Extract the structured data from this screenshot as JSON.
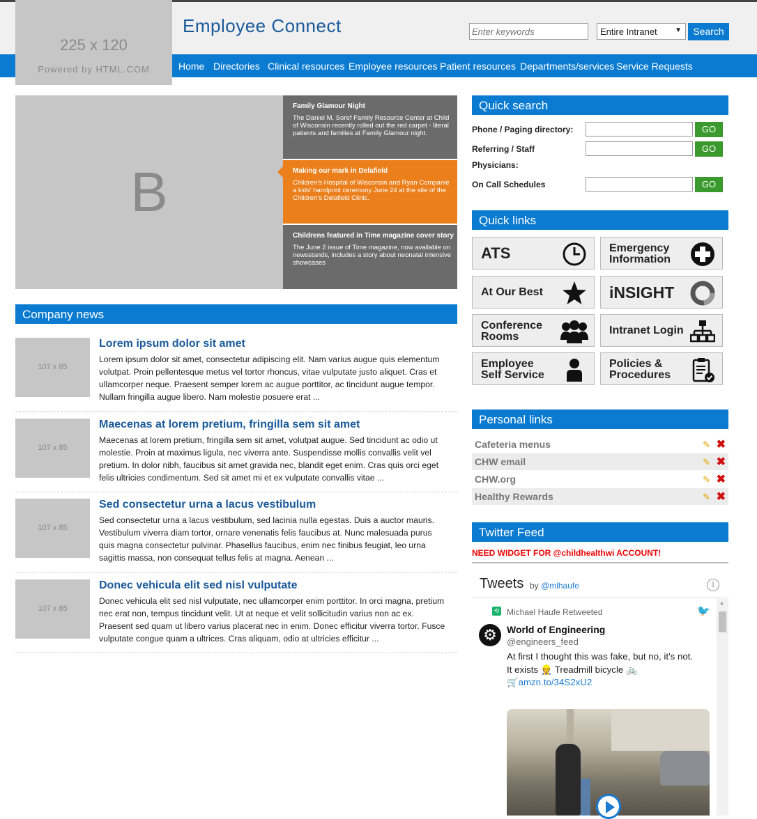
{
  "header": {
    "logo_dims": "225 x 120",
    "logo_powered": "Powered by HTML.COM",
    "site_title": "Employee Connect",
    "search_placeholder": "Enter keywords",
    "search_scope": "Entire Intranet",
    "search_button": "Search"
  },
  "nav": [
    "Home",
    "Directories",
    "Clinical resources",
    "Employee resources",
    "Patient resources",
    "Departments/services",
    "Service Requests"
  ],
  "carousel": {
    "image_letter": "B",
    "slides": [
      {
        "title": "Family Glamour Night",
        "body": [
          "The Daniel M. Soref Family Resource Center at Child",
          "of Wisconsin recently rolled out the red carpet - literal",
          "patients and families at Family Glamour night."
        ]
      },
      {
        "title": "Making our mark in Delafield",
        "body": [
          "Children's Hospital of Wisconsin and Ryan Companie",
          "a kids' handprint ceremony June 24 at the site of the",
          "Children's Delafield Clinic."
        ]
      },
      {
        "title": "Childrens featured in Time magazine cover story",
        "body": [
          "The June 2 issue of Time magazine, now available on",
          "newsstands, includes a story about neonatal intensive",
          "showcases"
        ]
      }
    ]
  },
  "company_news": {
    "heading": "Company news",
    "items": [
      {
        "thumb": "107 x 85",
        "title": "Lorem ipsum dolor sit amet",
        "body": [
          "Lorem ipsum dolor sit amet, consectetur adipiscing elit. Nam varius augue quis elementum",
          "volutpat. Proin pellentesque metus vel tortor rhoncus, vitae vulputate justo aliquet. Cras et",
          "ullamcorper neque. Praesent semper lorem ac augue porttitor, ac tincidunt augue tempor.",
          "Nullam fringilla augue libero. Nam molestie posuere erat ..."
        ]
      },
      {
        "thumb": "107 x 85",
        "title": "Maecenas at lorem pretium, fringilla sem sit amet",
        "body": [
          "Maecenas at lorem pretium, fringilla sem sit amet, volutpat augue. Sed tincidunt ac odio ut",
          "molestie. Proin at maximus ligula, nec viverra ante. Suspendisse mollis convallis velit vel",
          "pretium. In dolor nibh, faucibus sit amet gravida nec, blandit eget enim. Cras quis orci eget",
          "felis ultricies condimentum. Sed sit amet mi et ex vulputate convallis vitae ..."
        ]
      },
      {
        "thumb": "107 x 85",
        "title": "Sed consectetur urna a lacus vestibulum",
        "body": [
          "Sed consectetur urna a lacus vestibulum, sed lacinia nulla egestas. Duis a auctor mauris.",
          "Vestibulum viverra diam tortor, ornare venenatis felis faucibus at. Nunc malesuada purus",
          "quis magna consectetur pulvinar. Phasellus faucibus, enim nec finibus feugiat, leo urna",
          "sagittis massa, non consequat tellus felis at magna. Aenean ..."
        ]
      },
      {
        "thumb": "107 x 85",
        "title": "Donec vehicula elit sed nisl vulputate",
        "body": [
          "Donec vehicula elit sed nisl vulputate, nec ullamcorper enim porttitor. In orci magna, pretium",
          "nec erat non, tempus tincidunt velit. Ut at neque et velit sollicitudin varius non ac ex.",
          "Praesent sed quam ut libero varius placerat nec in enim. Donec efficitur viverra tortor. Fusce",
          "vulputate congue quam a ultrices. Cras aliquam, odio at ultricies efficitur ..."
        ]
      }
    ]
  },
  "quick_search": {
    "heading": "Quick search",
    "rows": [
      {
        "label": "Phone / Paging directory:",
        "go": "GO"
      },
      {
        "label": "Referring / Staff",
        "label2": "Physicians:",
        "go": "GO"
      },
      {
        "label": "On Call Schedules",
        "go": "GO"
      }
    ]
  },
  "quick_links": {
    "heading": "Quick links",
    "tiles": [
      {
        "label": [
          "ATS"
        ],
        "icon": "clock-icon"
      },
      {
        "label": [
          "Emergency",
          "Information"
        ],
        "icon": "plus-circle-icon"
      },
      {
        "label": [
          "At Our Best"
        ],
        "icon": "star-icon"
      },
      {
        "label": [
          "iNSIGHT"
        ],
        "icon": "ring-icon"
      },
      {
        "label": [
          "Conference",
          "Rooms"
        ],
        "icon": "group-icon"
      },
      {
        "label": [
          "Intranet Login"
        ],
        "icon": "network-icon"
      },
      {
        "label": [
          "Employee",
          "Self Service"
        ],
        "icon": "user-icon"
      },
      {
        "label": [
          "Policies &",
          "Procedures"
        ],
        "icon": "clipboard-check-icon"
      }
    ]
  },
  "personal_links": {
    "heading": "Personal links",
    "items": [
      "Cafeteria menus",
      "CHW email",
      "CHW.org",
      "Healthy Rewards"
    ],
    "edit_glyph": "✎",
    "delete_glyph": "✖"
  },
  "twitter": {
    "heading": "Twitter Feed",
    "notice": "NEED WIDGET FOR @childhealthwi ACCOUNT!",
    "widget_title": "Tweets",
    "by": "by",
    "by_handle": "@mlhaufe",
    "retweeted_by": "Michael Haufe Retweeted",
    "author_name": "World of Engineering",
    "author_handle": "@engineers_feed",
    "tweet_lines": [
      "At first I thought this was fake, but no, it's not.",
      "It exists 👷 Treadmill bicycle 🚲"
    ],
    "tweet_link": "amzn.to/34S2xU2",
    "cart_glyph": "🛒"
  }
}
